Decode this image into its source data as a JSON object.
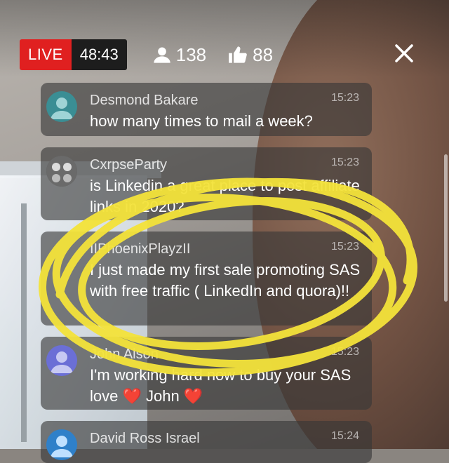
{
  "live": {
    "label": "LIVE",
    "elapsed": "48:43"
  },
  "stats": {
    "viewers": "138",
    "likes": "88"
  },
  "messages": [
    {
      "name": "Desmond Bakare",
      "time": "15:23",
      "text": "how many times to mail a week?"
    },
    {
      "name": "CxrpseParty",
      "time": "15:23",
      "text": "is Linkedin a great place to post affiliate links in 2020?"
    },
    {
      "name": "IIPhoenixPlayzII",
      "time": "15:23",
      "text": "I just made my first sale promoting SAS with free traffic ( LinkedIn and quora)!!"
    },
    {
      "name": "John Alson",
      "time": "15:23",
      "text": "I'm working hard now to buy your SAS love ❤️ John ❤️"
    },
    {
      "name": "David Ross Israel",
      "time": "15:24",
      "text": ""
    }
  ],
  "colors": {
    "live_red": "#e02020",
    "annotation_yellow": "#f4e33a",
    "avatar_teal": "#3a8e94",
    "avatar_blue": "#2f80c9",
    "avatar_indigo": "#6b6fd6"
  }
}
